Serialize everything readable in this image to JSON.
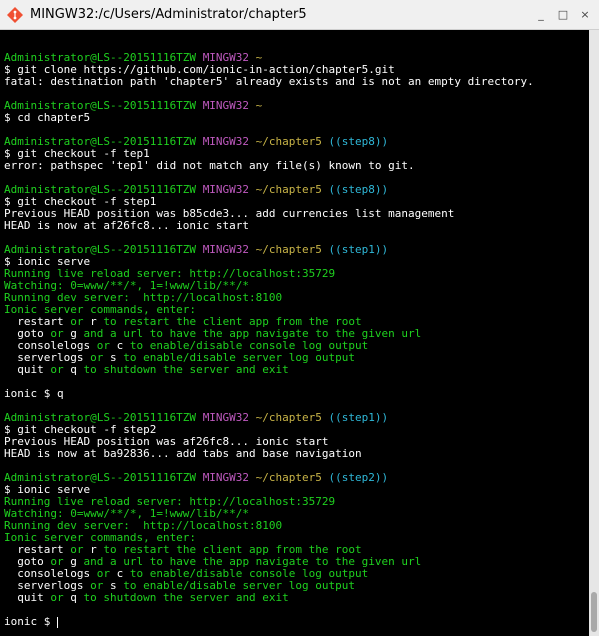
{
  "window": {
    "title": "MINGW32:/c/Users/Administrator/chapter5",
    "controls": {
      "minimize": "_",
      "maximize": "□",
      "close": "×"
    },
    "icon": "git-bash-icon"
  },
  "terminal": {
    "prompt_user": "Administrator@LS--20151116TZW",
    "prompt_env": "MINGW32",
    "lines": [
      {
        "kind": "blank"
      },
      {
        "kind": "prompt",
        "path": "~",
        "branch": ""
      },
      {
        "kind": "cmd",
        "text": "$ git clone https://github.com/ionic-in-action/chapter5.git"
      },
      {
        "kind": "out",
        "text": "fatal: destination path 'chapter5' already exists and is not an empty directory."
      },
      {
        "kind": "blank"
      },
      {
        "kind": "prompt",
        "path": "~",
        "branch": ""
      },
      {
        "kind": "cmd",
        "text": "$ cd chapter5"
      },
      {
        "kind": "blank"
      },
      {
        "kind": "prompt",
        "path": "~/chapter5",
        "branch": "((step8))"
      },
      {
        "kind": "cmd",
        "text": "$ git checkout -f tep1"
      },
      {
        "kind": "out",
        "text": "error: pathspec 'tep1' did not match any file(s) known to git."
      },
      {
        "kind": "blank"
      },
      {
        "kind": "prompt",
        "path": "~/chapter5",
        "branch": "((step8))"
      },
      {
        "kind": "cmd",
        "text": "$ git checkout -f step1"
      },
      {
        "kind": "out",
        "text": "Previous HEAD position was b85cde3... add currencies list management"
      },
      {
        "kind": "out",
        "text": "HEAD is now at af26fc8... ionic start"
      },
      {
        "kind": "blank"
      },
      {
        "kind": "prompt",
        "path": "~/chapter5",
        "branch": "((step1))"
      },
      {
        "kind": "cmd",
        "text": "$ ionic serve"
      },
      {
        "kind": "green",
        "text": "Running live reload server: http://localhost:35729"
      },
      {
        "kind": "green",
        "text": "Watching: 0=www/**/*, 1=!www/lib/**/*"
      },
      {
        "kind": "green",
        "text": "Running dev server:  http://localhost:8100"
      },
      {
        "kind": "green",
        "text": "Ionic server commands, enter:"
      },
      {
        "kind": "mix",
        "parts": [
          [
            "w",
            "  restart"
          ],
          [
            "g",
            " or "
          ],
          [
            "w",
            "r"
          ],
          [
            "g",
            " to restart the client app from the root"
          ]
        ]
      },
      {
        "kind": "mix",
        "parts": [
          [
            "w",
            "  goto"
          ],
          [
            "g",
            " or "
          ],
          [
            "w",
            "g"
          ],
          [
            "g",
            " and a url to have the app navigate to the given url"
          ]
        ]
      },
      {
        "kind": "mix",
        "parts": [
          [
            "w",
            "  consolelogs"
          ],
          [
            "g",
            " or "
          ],
          [
            "w",
            "c"
          ],
          [
            "g",
            " to enable/disable console log output"
          ]
        ]
      },
      {
        "kind": "mix",
        "parts": [
          [
            "w",
            "  serverlogs"
          ],
          [
            "g",
            " or "
          ],
          [
            "w",
            "s"
          ],
          [
            "g",
            " to enable/disable server log output"
          ]
        ]
      },
      {
        "kind": "mix",
        "parts": [
          [
            "w",
            "  quit"
          ],
          [
            "g",
            " or "
          ],
          [
            "w",
            "q"
          ],
          [
            "g",
            " to shutdown the server and exit"
          ]
        ]
      },
      {
        "kind": "blank"
      },
      {
        "kind": "out",
        "text": "ionic $ q"
      },
      {
        "kind": "blank"
      },
      {
        "kind": "prompt",
        "path": "~/chapter5",
        "branch": "((step1))"
      },
      {
        "kind": "cmd",
        "text": "$ git checkout -f step2"
      },
      {
        "kind": "out",
        "text": "Previous HEAD position was af26fc8... ionic start"
      },
      {
        "kind": "out",
        "text": "HEAD is now at ba92836... add tabs and base navigation"
      },
      {
        "kind": "blank"
      },
      {
        "kind": "prompt",
        "path": "~/chapter5",
        "branch": "((step2))"
      },
      {
        "kind": "cmd",
        "text": "$ ionic serve"
      },
      {
        "kind": "green",
        "text": "Running live reload server: http://localhost:35729"
      },
      {
        "kind": "green",
        "text": "Watching: 0=www/**/*, 1=!www/lib/**/*"
      },
      {
        "kind": "green",
        "text": "Running dev server:  http://localhost:8100"
      },
      {
        "kind": "green",
        "text": "Ionic server commands, enter:"
      },
      {
        "kind": "mix",
        "parts": [
          [
            "w",
            "  restart"
          ],
          [
            "g",
            " or "
          ],
          [
            "w",
            "r"
          ],
          [
            "g",
            " to restart the client app from the root"
          ]
        ]
      },
      {
        "kind": "mix",
        "parts": [
          [
            "w",
            "  goto"
          ],
          [
            "g",
            " or "
          ],
          [
            "w",
            "g"
          ],
          [
            "g",
            " and a url to have the app navigate to the given url"
          ]
        ]
      },
      {
        "kind": "mix",
        "parts": [
          [
            "w",
            "  consolelogs"
          ],
          [
            "g",
            " or "
          ],
          [
            "w",
            "c"
          ],
          [
            "g",
            " to enable/disable console log output"
          ]
        ]
      },
      {
        "kind": "mix",
        "parts": [
          [
            "w",
            "  serverlogs"
          ],
          [
            "g",
            " or "
          ],
          [
            "w",
            "s"
          ],
          [
            "g",
            " to enable/disable server log output"
          ]
        ]
      },
      {
        "kind": "mix",
        "parts": [
          [
            "w",
            "  quit"
          ],
          [
            "g",
            " or "
          ],
          [
            "w",
            "q"
          ],
          [
            "g",
            " to shutdown the server and exit"
          ]
        ]
      },
      {
        "kind": "blank"
      },
      {
        "kind": "cursor",
        "text": "ionic $ "
      }
    ]
  },
  "colors": {
    "background": "#000000",
    "text": "#ffffff",
    "green": "#1fd11f",
    "magenta": "#c05ac0",
    "yellow": "#c8b447",
    "cyan": "#2fb8d8"
  }
}
